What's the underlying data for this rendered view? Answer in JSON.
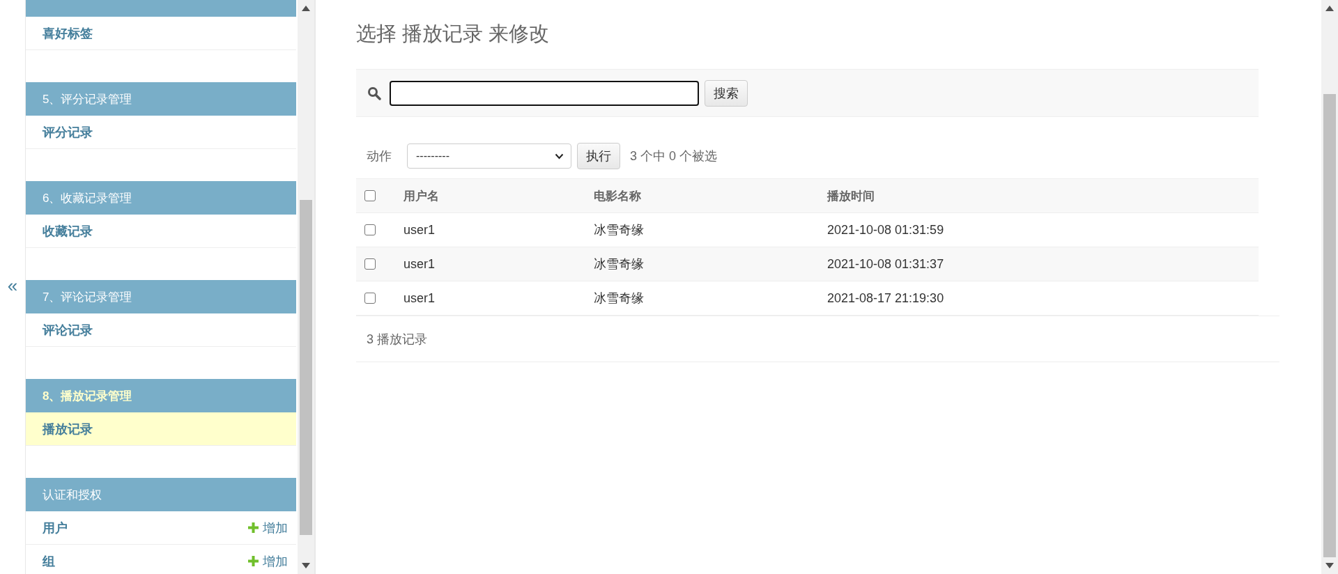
{
  "collapse_toggle": "«",
  "sidebar": {
    "modules": [
      {
        "items": [
          {
            "label": "喜好标签",
            "selected": false
          }
        ]
      },
      {
        "caption": "5、评分记录管理",
        "selected": false,
        "items": [
          {
            "label": "评分记录",
            "selected": false
          }
        ]
      },
      {
        "caption": "6、收藏记录管理",
        "selected": false,
        "items": [
          {
            "label": "收藏记录",
            "selected": false
          }
        ]
      },
      {
        "caption": "7、评论记录管理",
        "selected": false,
        "items": [
          {
            "label": "评论记录",
            "selected": false
          }
        ]
      },
      {
        "caption": "8、播放记录管理",
        "selected": true,
        "items": [
          {
            "label": "播放记录",
            "selected": true
          }
        ]
      },
      {
        "caption": "认证和授权",
        "selected": false,
        "items": [
          {
            "label": "用户",
            "selected": false,
            "add_label": "增加"
          },
          {
            "label": "组",
            "selected": false,
            "add_label": "增加"
          }
        ]
      }
    ]
  },
  "page_title": "选择 播放记录 来修改",
  "search": {
    "focused": true,
    "button": "搜索"
  },
  "actions": {
    "label": "动作",
    "select_value": "---------",
    "button": "执行",
    "selection_count": "3 个中 0 个被选"
  },
  "table": {
    "select_all_checked": false,
    "columns": [
      "用户名",
      "电影名称",
      "播放时间"
    ],
    "rows": [
      {
        "checked": false,
        "cells": [
          "user1",
          "冰雪奇缘",
          "2021-10-08 01:31:59"
        ]
      },
      {
        "checked": false,
        "cells": [
          "user1",
          "冰雪奇缘",
          "2021-10-08 01:31:37"
        ]
      },
      {
        "checked": false,
        "cells": [
          "user1",
          "冰雪奇缘",
          "2021-08-17 21:19:30"
        ]
      }
    ]
  },
  "paginator": "3 播放记录"
}
